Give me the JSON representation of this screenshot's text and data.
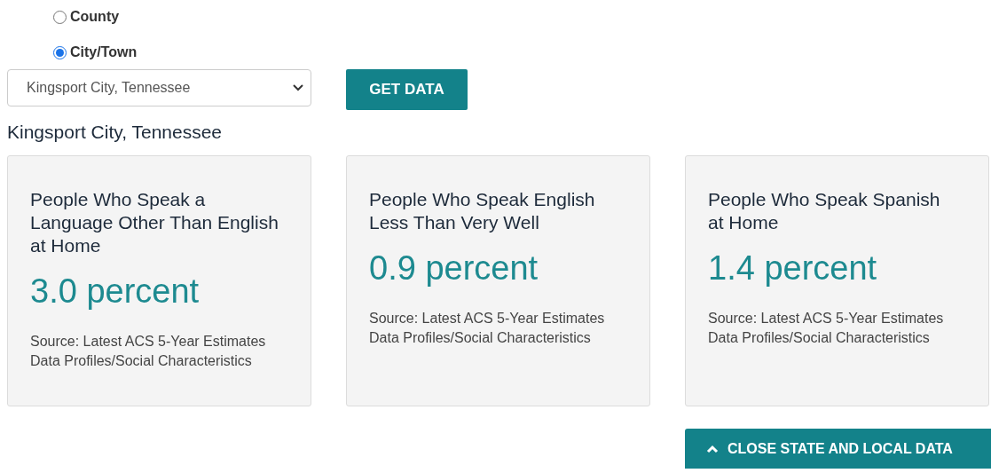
{
  "geography_options": [
    {
      "label": "County",
      "selected": false
    },
    {
      "label": "City/Town",
      "selected": true
    }
  ],
  "place_select": {
    "value": "Kingsport City, Tennessee"
  },
  "get_data_button": "GET DATA",
  "place_heading": "Kingsport City, Tennessee",
  "cards": [
    {
      "title": "People Who Speak a Language Other Than English at Home",
      "value": "3.0 percent",
      "source": "Source: Latest ACS 5-Year Estimates Data Profiles/Social Characteristics"
    },
    {
      "title": "People Who Speak English Less Than Very Well",
      "value": "0.9 percent",
      "source": "Source: Latest ACS 5-Year Estimates Data Profiles/Social Characteristics"
    },
    {
      "title": "People Who Speak Spanish at Home",
      "value": "1.4 percent",
      "source": "Source: Latest ACS 5-Year Estimates Data Profiles/Social Characteristics"
    }
  ],
  "close_button": "CLOSE STATE AND LOCAL DATA"
}
